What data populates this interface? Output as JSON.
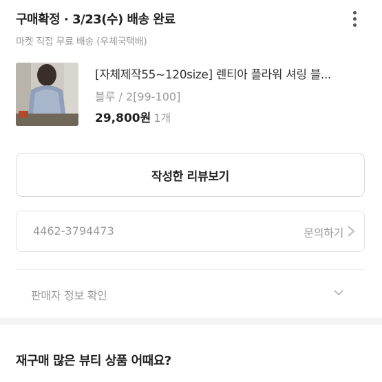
{
  "order": {
    "status": "구매확정 · 3/23(수) 배송 완료",
    "delivery_info": "마켓 직접 무료 배송 (우체국택배)"
  },
  "product": {
    "name": "[자체제작55~120size] 렌티아 플라워 셔링 블...",
    "option": "블루 / 2[99-100]",
    "price": "29,800원",
    "quantity": "1개"
  },
  "actions": {
    "review_button": "작성한 리뷰보기",
    "order_number": "4462-3794473",
    "inquiry_link": "문의하기",
    "seller_info": "판매자 정보 확인"
  },
  "recommendation": {
    "title": "재구매 많은 뷰티 상품 어때요?"
  },
  "icons": {
    "more": "more-vertical-icon",
    "chevron_right": "chevron-right-icon",
    "chevron_down": "chevron-down-icon"
  }
}
